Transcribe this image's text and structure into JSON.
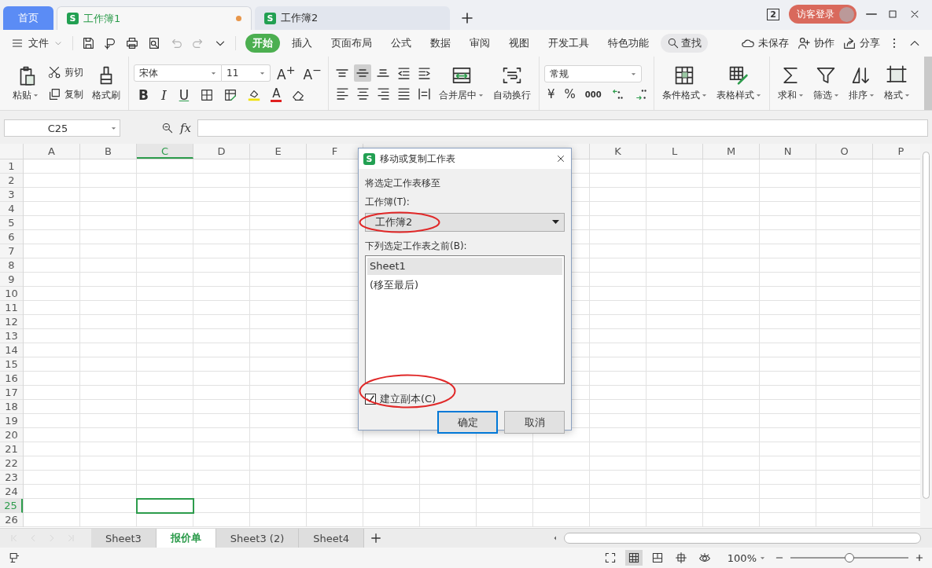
{
  "title_bar": {
    "tabs": [
      {
        "label": "首页",
        "kind": "home",
        "selected": false
      },
      {
        "label": "工作簿1",
        "kind": "document",
        "icon_letter": "S",
        "selected": true,
        "unsaved": true
      },
      {
        "label": "工作簿2",
        "kind": "document",
        "icon_letter": "S",
        "selected": false,
        "unsaved": false
      }
    ],
    "window_count": "2",
    "login": "访客登录"
  },
  "menu_bar": {
    "file": "文件",
    "quick_tools": [
      {
        "disabled": false
      },
      {
        "disabled": false
      },
      {
        "disabled": false
      },
      {
        "disabled": false
      },
      {
        "disabled": true
      },
      {
        "disabled": true
      },
      {
        "disabled": false
      }
    ],
    "tabs": [
      {
        "label": "开始",
        "selected": true
      },
      {
        "label": "插入",
        "selected": false
      },
      {
        "label": "页面布局",
        "selected": false
      },
      {
        "label": "公式",
        "selected": false
      },
      {
        "label": "数据",
        "selected": false
      },
      {
        "label": "审阅",
        "selected": false
      },
      {
        "label": "视图",
        "selected": false
      },
      {
        "label": "开发工具",
        "selected": false
      },
      {
        "label": "特色功能",
        "selected": false
      }
    ],
    "search": "查找",
    "actions": [
      "未保存",
      "协作",
      "分享"
    ]
  },
  "ribbon": {
    "paste": "粘贴",
    "cut": "剪切",
    "copy": "复制",
    "format_painter": "格式刷",
    "font_name": "宋体",
    "font_size": "11",
    "font_grow": "A$^{+}$",
    "font_shrink": "A$^{−}$",
    "bold": "B",
    "italic": "I",
    "underline": "U",
    "font_color": "A",
    "align_buttons": [
      {
        "selected": false
      },
      {
        "selected": true
      },
      {
        "selected": false
      },
      {
        "selected": false
      },
      {
        "selected": false
      },
      {
        "selected": false
      },
      {
        "selected": false
      },
      {
        "selected": false
      },
      {
        "selected": false
      },
      {
        "selected": false
      }
    ],
    "merge": "合并居中",
    "wrap": "自动换行",
    "number_format": "常规",
    "currency": "¥",
    "percent": "%",
    "thousands": "000",
    "conditional_format": "条件格式",
    "table_style": "表格样式",
    "tools": [
      "求和",
      "筛选",
      "排序",
      "格式"
    ]
  },
  "formula_bar": {
    "name_box": "C25",
    "function_label": "fx"
  },
  "grid": {
    "columns_left": [
      {
        "label": "A",
        "selected": false
      },
      {
        "label": "B",
        "selected": false
      },
      {
        "label": "C",
        "selected": true
      },
      {
        "label": "D",
        "selected": false
      },
      {
        "label": "E",
        "selected": false
      },
      {
        "label": "F",
        "selected": false
      }
    ],
    "columns_right": [
      {
        "label": "K",
        "selected": false
      },
      {
        "label": "L",
        "selected": false
      },
      {
        "label": "M",
        "selected": false
      },
      {
        "label": "N",
        "selected": false
      },
      {
        "label": "O",
        "selected": false
      },
      {
        "label": "P",
        "selected": false
      }
    ],
    "rows": [
      {
        "label": "1",
        "selected": false
      },
      {
        "label": "2",
        "selected": false
      },
      {
        "label": "3",
        "selected": false
      },
      {
        "label": "4",
        "selected": false
      },
      {
        "label": "5",
        "selected": false
      },
      {
        "label": "6",
        "selected": false
      },
      {
        "label": "7",
        "selected": false
      },
      {
        "label": "8",
        "selected": false
      },
      {
        "label": "9",
        "selected": false
      },
      {
        "label": "10",
        "selected": false
      },
      {
        "label": "11",
        "selected": false
      },
      {
        "label": "12",
        "selected": false
      },
      {
        "label": "13",
        "selected": false
      },
      {
        "label": "14",
        "selected": false
      },
      {
        "label": "15",
        "selected": false
      },
      {
        "label": "16",
        "selected": false
      },
      {
        "label": "17",
        "selected": false
      },
      {
        "label": "18",
        "selected": false
      },
      {
        "label": "19",
        "selected": false
      },
      {
        "label": "20",
        "selected": false
      },
      {
        "label": "21",
        "selected": false
      },
      {
        "label": "22",
        "selected": false
      },
      {
        "label": "23",
        "selected": false
      },
      {
        "label": "24",
        "selected": false
      },
      {
        "label": "25",
        "selected": true
      },
      {
        "label": "26",
        "selected": false
      }
    ]
  },
  "dialog": {
    "title": "移动或复制工作表",
    "icon_letter": "S",
    "instruction": "将选定工作表移至",
    "workbook_label": "工作簿(T):",
    "workbook_value": "工作簿2",
    "before_label": "下列选定工作表之前(B):",
    "sheets": [
      {
        "label": "Sheet1",
        "selected": true
      },
      {
        "label": "(移至最后)",
        "selected": false
      }
    ],
    "copy_option": {
      "label": "建立副本(C)",
      "checked": true
    },
    "buttons": [
      {
        "label": "确定",
        "kind": "primary"
      },
      {
        "label": "取消",
        "kind": "normal"
      }
    ]
  },
  "sheet_tabs": [
    {
      "label": "Sheet3",
      "selected": false
    },
    {
      "label": "报价单",
      "selected": true
    },
    {
      "label": "Sheet3 (2)",
      "selected": false
    },
    {
      "label": "Sheet4",
      "selected": false
    }
  ],
  "status_bar": {
    "views": [
      {
        "selected": false
      },
      {
        "selected": true
      },
      {
        "selected": false
      },
      {
        "selected": false
      },
      {
        "selected": false
      }
    ],
    "zoom": "100%",
    "zoom_slider": {
      "level": 0.5
    }
  }
}
